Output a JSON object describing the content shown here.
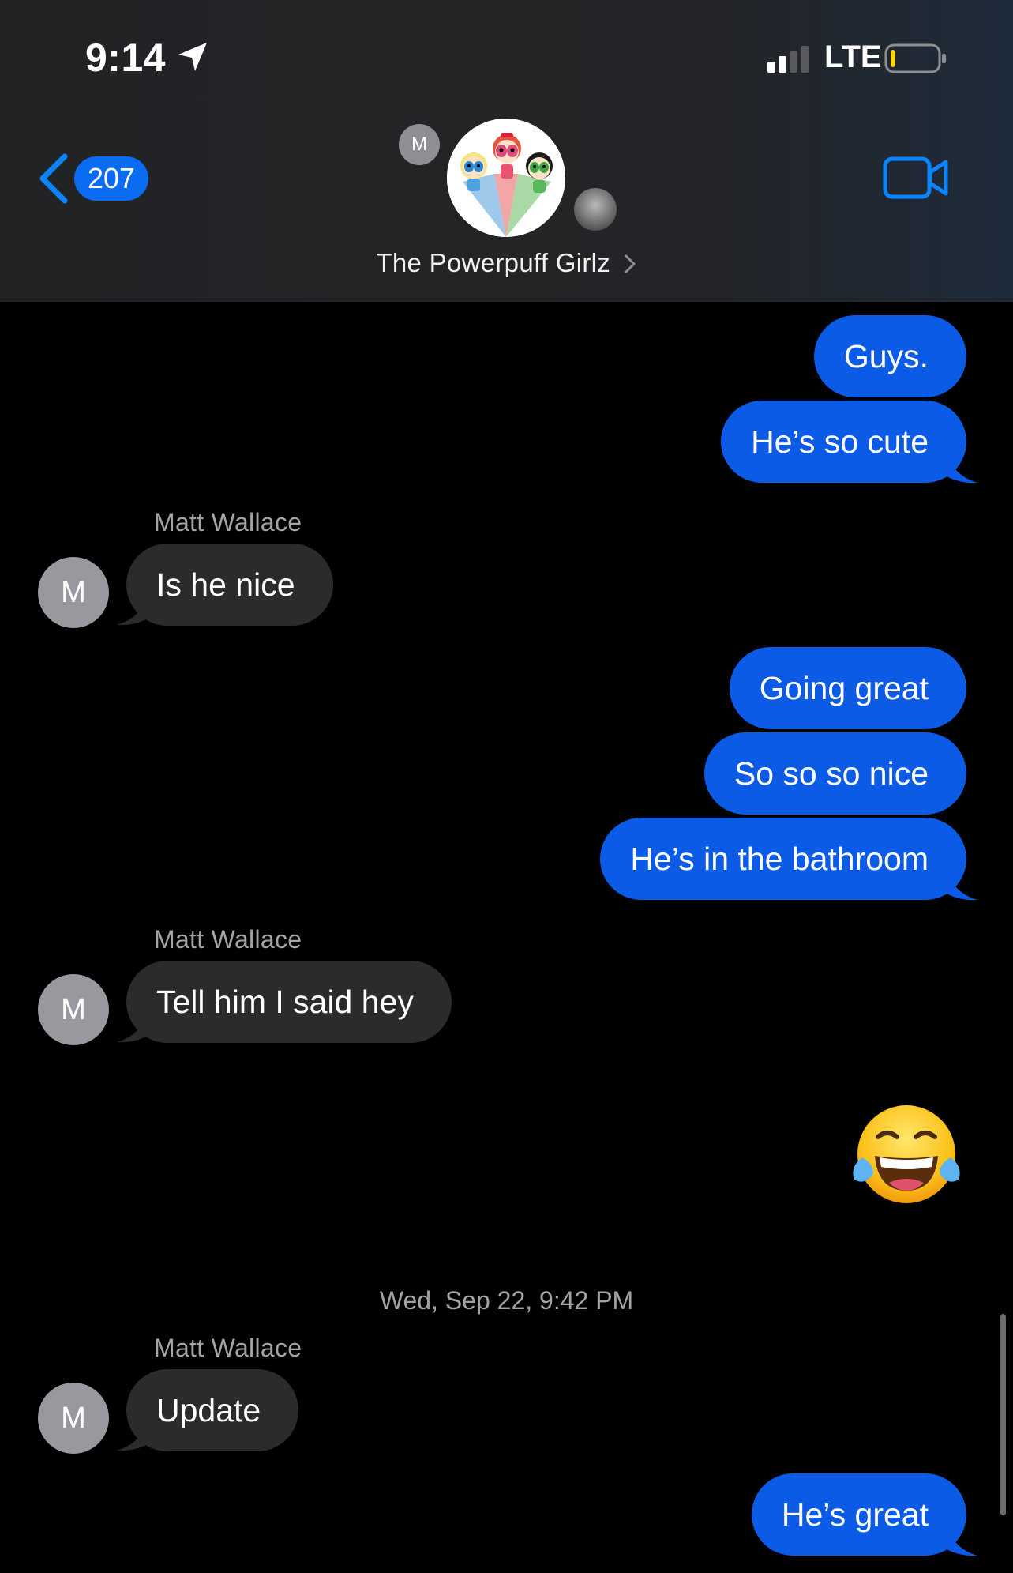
{
  "status_bar": {
    "time": "9:14",
    "network": "LTE",
    "battery_level": 0.1,
    "icons": [
      "location-arrow-icon",
      "signal-icon",
      "battery-icon"
    ]
  },
  "nav": {
    "back_count": "207",
    "group_name": "The Powerpuff Girlz",
    "mini_avatar_initial": "M",
    "icons": [
      "chevron-left-icon",
      "video-camera-icon",
      "chevron-right-icon"
    ]
  },
  "colors": {
    "outgoing_bubble": "#0b5be6",
    "incoming_bubble": "#2b2b2e",
    "accent": "#0a84ff",
    "background": "#000000"
  },
  "messages": [
    {
      "direction": "outgoing",
      "text": "Guys."
    },
    {
      "direction": "outgoing",
      "text": "He’s so cute"
    },
    {
      "direction": "incoming",
      "sender": "Matt Wallace",
      "avatar_initial": "M",
      "text": "Is he nice"
    },
    {
      "direction": "outgoing",
      "text": "Going great"
    },
    {
      "direction": "outgoing",
      "text": "So so so nice"
    },
    {
      "direction": "outgoing",
      "text": "He’s in the bathroom"
    },
    {
      "direction": "incoming",
      "sender": "Matt Wallace",
      "avatar_initial": "M",
      "text": "Tell him I said hey"
    },
    {
      "direction": "outgoing",
      "emoji": "face-with-tears-of-joy-icon"
    },
    {
      "timestamp": "Wed, Sep 22, 9:42 PM"
    },
    {
      "direction": "incoming",
      "sender": "Matt Wallace",
      "avatar_initial": "M",
      "text": "Update"
    },
    {
      "direction": "outgoing",
      "text": "He’s great"
    }
  ]
}
